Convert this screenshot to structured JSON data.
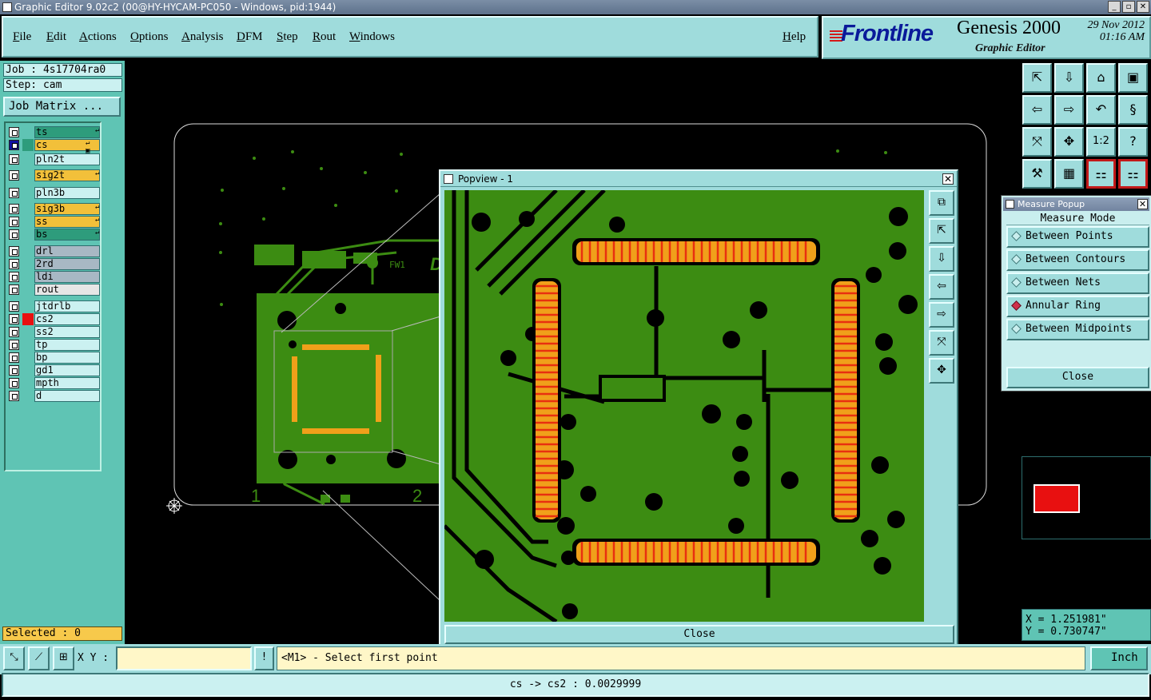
{
  "window": {
    "title": "Graphic Editor 9.02c2 (00@HY-HYCAM-PC050 - Windows, pid:1944)",
    "minimize": "_",
    "maximize": "▫",
    "close": "✕"
  },
  "menu": {
    "items": [
      "File",
      "Edit",
      "Actions",
      "Options",
      "Analysis",
      "DFM",
      "Step",
      "Rout",
      "Windows"
    ],
    "help": "Help"
  },
  "brand": {
    "logo": "Frontline",
    "product": "Genesis 2000",
    "subtitle": "Graphic Editor",
    "date": "29 Nov 2012",
    "time": "01:16 AM",
    "accent": "#0a1a9a"
  },
  "job": {
    "job_line": "Job : 4s17704ra0",
    "step_line": "Step: cam",
    "matrix_button": "Job Matrix ..."
  },
  "layers": [
    {
      "name": "ts",
      "color": "#2e9c7c",
      "mark": "↵",
      "swatch": ""
    },
    {
      "name": "cs",
      "color": "#f2c03a",
      "mark": "↵ ▣",
      "swatch": "#2e9c7c",
      "affected": true
    },
    {
      "name": "pln2t",
      "color": "#cbf1f1",
      "mark": "",
      "swatch": ""
    },
    {
      "name": "sig2t",
      "color": "#f2c03a",
      "mark": "↵",
      "swatch": ""
    },
    {
      "name": "pln3b",
      "color": "#cbf1f1",
      "mark": "",
      "swatch": ""
    },
    {
      "name": "sig3b",
      "color": "#f2c03a",
      "mark": "↵",
      "swatch": ""
    },
    {
      "name": "ss",
      "color": "#f2c03a",
      "mark": "↵",
      "swatch": ""
    },
    {
      "name": "bs",
      "color": "#2e9c7c",
      "mark": "↵",
      "swatch": ""
    },
    {
      "name": "drl",
      "color": "#a8b8c4",
      "mark": "",
      "swatch": ""
    },
    {
      "name": "2rd",
      "color": "#a8b8c4",
      "mark": "",
      "swatch": ""
    },
    {
      "name": "ldi",
      "color": "#a8b8c4",
      "mark": "",
      "swatch": ""
    },
    {
      "name": "rout",
      "color": "#e6e6e6",
      "mark": "",
      "swatch": ""
    },
    {
      "name": "jtdrlb",
      "color": "#cbf1f1",
      "mark": "",
      "swatch": ""
    },
    {
      "name": "cs2",
      "color": "#cbf1f1",
      "mark": "",
      "swatch": "#e81010"
    },
    {
      "name": "ss2",
      "color": "#cbf1f1",
      "mark": "",
      "swatch": ""
    },
    {
      "name": "tp",
      "color": "#cbf1f1",
      "mark": "",
      "swatch": ""
    },
    {
      "name": "bp",
      "color": "#cbf1f1",
      "mark": "",
      "swatch": ""
    },
    {
      "name": "gd1",
      "color": "#cbf1f1",
      "mark": "",
      "swatch": ""
    },
    {
      "name": "mpth",
      "color": "#cbf1f1",
      "mark": "",
      "swatch": ""
    },
    {
      "name": "d",
      "color": "#cbf1f1",
      "mark": "",
      "swatch": ""
    }
  ],
  "selected": "Selected : 0",
  "canvas": {
    "board_labels": [
      "1",
      "2"
    ],
    "silk_text": "FW1"
  },
  "popview": {
    "title": "Popview - 1",
    "close_label": "Close",
    "close_x": "✕"
  },
  "measure": {
    "title": "Measure Popup",
    "mode_label": "Measure Mode",
    "options": [
      "Between Points",
      "Between Contours",
      "Between Nets",
      "Annular Ring",
      "Between Midpoints"
    ],
    "selected_option": "Annular Ring",
    "close_label": "Close",
    "close_x": "✕"
  },
  "coords": {
    "x": "X = 1.251981\"",
    "y": "Y = 0.730747\""
  },
  "bottom": {
    "xy_label": "X Y :",
    "xy_value": "",
    "info_icon": "!",
    "prompt": "<M1> - Select first point",
    "unit": "Inch"
  },
  "status": "cs -> cs2 : 0.0029999",
  "colors": {
    "panel": "#9fdcdc",
    "pcb_green": "#3c8c12",
    "pad_orange": "#f0a01a",
    "pad_red": "#e83010",
    "accent_red": "#e81010"
  },
  "icons": [
    "zoom-home-icon",
    "zoom-in-icon",
    "zoom-out-icon",
    "pan-icon",
    "measure-icon",
    "snap-icon",
    "help-icon"
  ]
}
